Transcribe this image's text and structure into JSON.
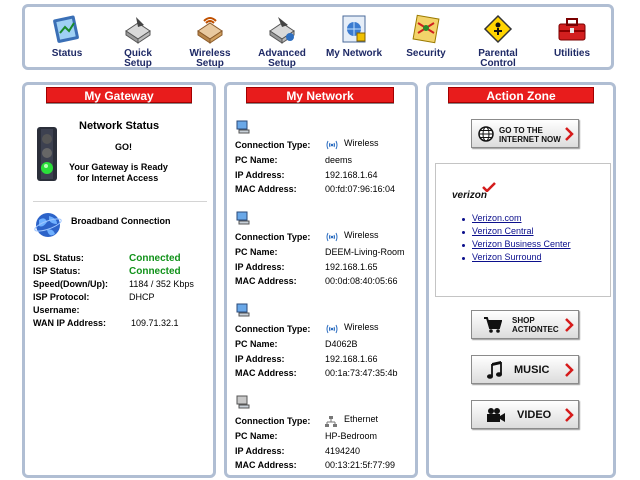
{
  "nav": [
    {
      "label1": "Status",
      "label2": "",
      "icon": "status-icon"
    },
    {
      "label1": "Quick",
      "label2": "Setup",
      "icon": "quick-setup-icon"
    },
    {
      "label1": "Wireless",
      "label2": "Setup",
      "icon": "wireless-setup-icon"
    },
    {
      "label1": "Advanced",
      "label2": "Setup",
      "icon": "advanced-setup-icon"
    },
    {
      "label1": "My Network",
      "label2": "",
      "icon": "my-network-icon"
    },
    {
      "label1": "Security",
      "label2": "",
      "icon": "security-icon"
    },
    {
      "label1": "Parental",
      "label2": "Control",
      "icon": "parental-control-icon"
    },
    {
      "label1": "Utilities",
      "label2": "",
      "icon": "utilities-icon"
    }
  ],
  "gateway": {
    "title": "My Gateway",
    "status_heading": "Network Status",
    "go": "GO!",
    "ready1": "Your Gateway is Ready",
    "ready2": "for Internet Access",
    "broadband": "Broadband Connection",
    "rows": [
      {
        "label": "DSL Status:",
        "value": "Connected",
        "green": true
      },
      {
        "label": "ISP Status:",
        "value": "Connected",
        "green": true
      },
      {
        "label": "Speed(Down/Up):",
        "value": "1184 / 352 Kbps",
        "green": false
      },
      {
        "label": "ISP Protocol:",
        "value": "DHCP",
        "green": false
      },
      {
        "label": "Username:",
        "value": "",
        "green": false
      },
      {
        "label": "WAN IP Address:",
        "value": "109.71.32.1",
        "green": false
      }
    ]
  },
  "network": {
    "title": "My Network",
    "labels": {
      "conn": "Connection Type:",
      "pc": "PC Name:",
      "ip": "IP Address:",
      "mac": "MAC Address:"
    },
    "devices": [
      {
        "type": "Wireless",
        "pc": "deems",
        "ip": "192.168.1.64",
        "mac": "00:fd:07:96:16:04"
      },
      {
        "type": "Wireless",
        "pc": "DEEM-Living-Room",
        "ip": "192.168.1.65",
        "mac": "00:0d:08:40:05:66"
      },
      {
        "type": "Wireless",
        "pc": "D4062B",
        "ip": "192.168.1.66",
        "mac": "00:1a:73:47:35:4b"
      },
      {
        "type": "Ethernet",
        "pc": "HP-Bedroom",
        "ip": "4194240",
        "mac": "00:13:21:5f:77:99"
      }
    ]
  },
  "action": {
    "title": "Action Zone",
    "goto1": "GO TO THE",
    "goto2": "INTERNET NOW",
    "logo": "verizon",
    "links": [
      "Verizon.com",
      "Verizon Central",
      "Verizon Business Center",
      "Verizon Surround"
    ],
    "shop1": "SHOP",
    "shop2": "ACTIONTEC",
    "music": "MUSIC",
    "video": "VIDEO"
  },
  "colors": {
    "accent": "#e81c1c",
    "border": "#b0bed3",
    "nav_text": "#1f2a66",
    "connected": "#11921a",
    "link": "#0b0f8c"
  }
}
